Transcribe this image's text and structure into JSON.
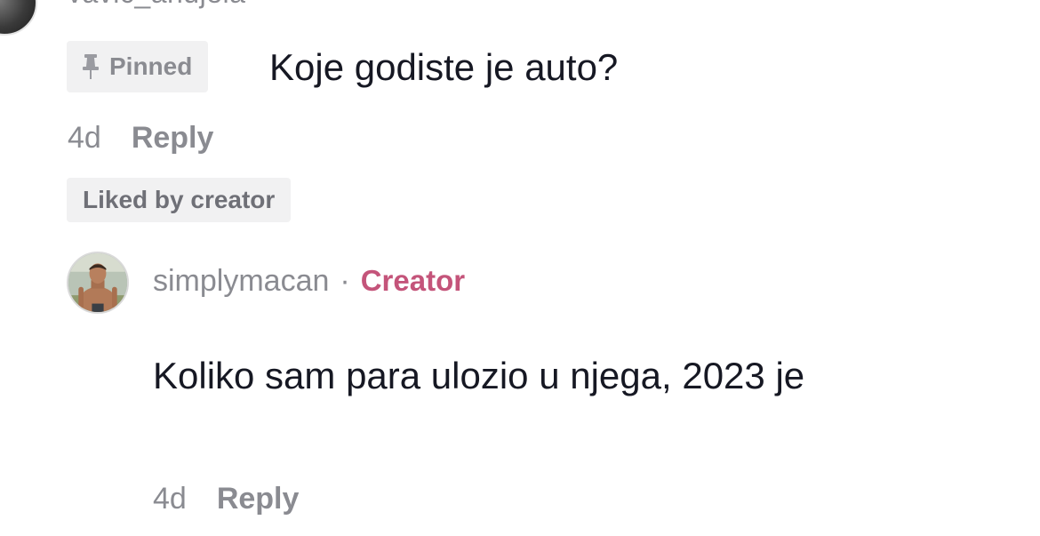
{
  "top_comment": {
    "username": "vavic_andjela",
    "pinned_label": "Pinned",
    "text": "Koje godiste je auto?",
    "time": "4d",
    "reply_label": "Reply",
    "liked_label": "Liked by creator",
    "avatar_icon": "user-avatar",
    "pin_icon": "pushpin-icon"
  },
  "creator_reply": {
    "username": "simplymacan",
    "separator": "·",
    "creator_label": "Creator",
    "text": "Koliko sam para ulozio u njega, 2023 je",
    "time": "4d",
    "reply_label": "Reply",
    "avatar_icon": "user-avatar"
  },
  "colors": {
    "text_primary": "#161823",
    "text_secondary": "#8a8b91",
    "badge_bg": "#f1f1f2",
    "creator_accent": "#c4547a"
  }
}
